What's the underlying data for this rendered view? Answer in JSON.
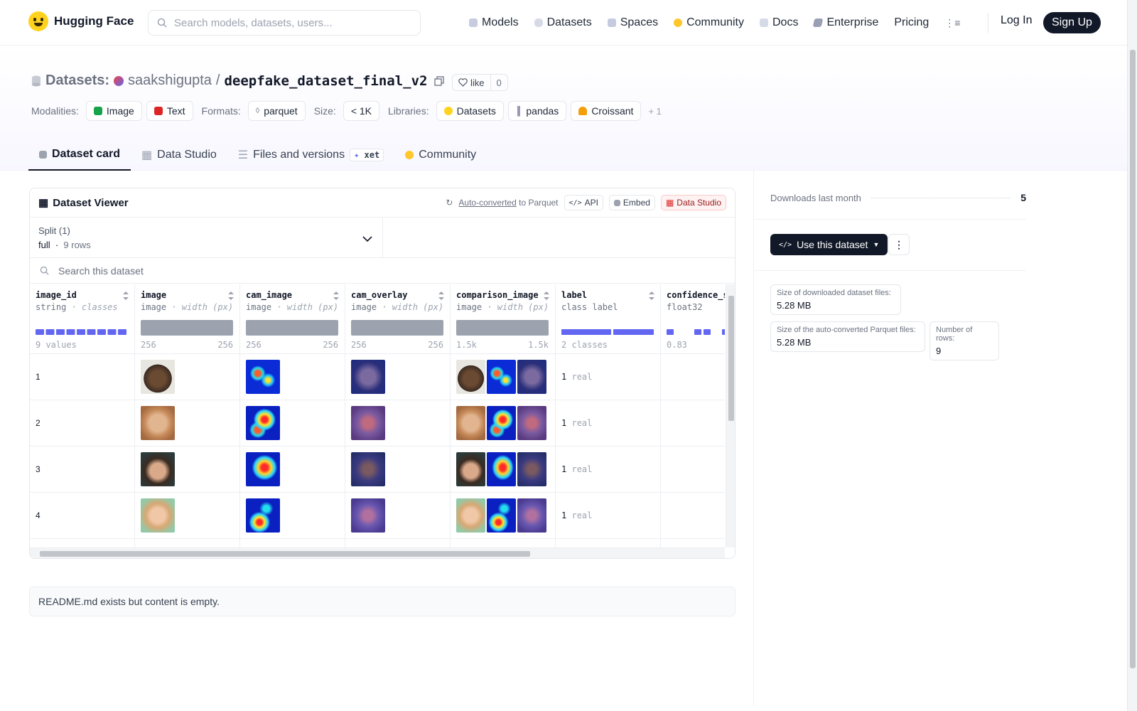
{
  "nav": {
    "brand": "Hugging Face",
    "search_placeholder": "Search models, datasets, users...",
    "links": [
      "Models",
      "Datasets",
      "Spaces",
      "Community",
      "Docs",
      "Enterprise",
      "Pricing"
    ],
    "login": "Log In",
    "signup": "Sign Up"
  },
  "header": {
    "section": "Datasets:",
    "user": "saakshigupta",
    "sep": "/",
    "name": "deepfake_dataset_final_v2",
    "like": "like",
    "like_count": "0",
    "modalities_label": "Modalities:",
    "modalities": [
      "Image",
      "Text"
    ],
    "formats_label": "Formats:",
    "formats": [
      "parquet"
    ],
    "size_label": "Size:",
    "size": "< 1K",
    "libraries_label": "Libraries:",
    "libraries": [
      "Datasets",
      "pandas",
      "Croissant"
    ],
    "more": "+ 1"
  },
  "tabs": [
    "Dataset card",
    "Data Studio",
    "Files and versions",
    "Community"
  ],
  "xet": "xet",
  "viewer": {
    "title": "Dataset Viewer",
    "auto": "Auto-converted",
    "to_parquet": "to Parquet",
    "api": "API",
    "embed": "Embed",
    "studio": "Data Studio",
    "split_title": "Split (1)",
    "split_value": "full",
    "split_rows": "9 rows",
    "search_placeholder": "Search this dataset",
    "columns": [
      {
        "name": "image_id",
        "type": "string",
        "sub": "· classes",
        "foot": "9 values"
      },
      {
        "name": "image",
        "type": "image",
        "sub": "· width (px)",
        "min": "256",
        "max": "256"
      },
      {
        "name": "cam_image",
        "type": "image",
        "sub": "· width (px)",
        "min": "256",
        "max": "256"
      },
      {
        "name": "cam_overlay",
        "type": "image",
        "sub": "· width (px)",
        "min": "256",
        "max": "256"
      },
      {
        "name": "comparison_image",
        "type": "image",
        "sub": "· width (px)",
        "min": "1.5k",
        "max": "1.5k"
      },
      {
        "name": "label",
        "type": "class label",
        "sub": "",
        "foot": "2 classes"
      },
      {
        "name": "confidence_sc",
        "type": "float32",
        "sub": "",
        "foot": "0.83"
      }
    ],
    "rows": [
      {
        "id": "1",
        "label_num": "1",
        "label_txt": "real"
      },
      {
        "id": "2",
        "label_num": "1",
        "label_txt": "real"
      },
      {
        "id": "3",
        "label_num": "1",
        "label_txt": "real"
      },
      {
        "id": "4",
        "label_num": "1",
        "label_txt": "real"
      }
    ]
  },
  "readme": "README.md exists but content is empty.",
  "side": {
    "downloads_label": "Downloads last month",
    "downloads": "5",
    "use_btn": "Use this dataset",
    "stats": [
      {
        "label": "Size of downloaded dataset files:",
        "value": "5.28 MB"
      },
      {
        "label": "Size of the auto-converted Parquet files:",
        "value": "5.28 MB"
      },
      {
        "label": "Number of rows:",
        "value": "9"
      }
    ]
  },
  "colors": {
    "accent": "#6366f1",
    "dark": "#111827",
    "hf_yellow": "#ffd21e"
  }
}
